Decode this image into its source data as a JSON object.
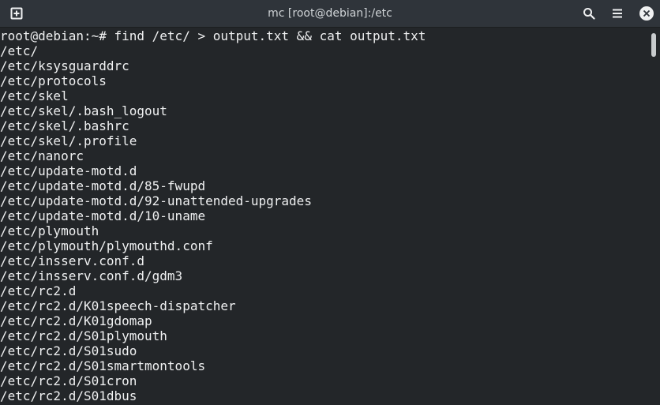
{
  "window": {
    "title": "mc [root@debian]:/etc"
  },
  "icons": {
    "new_tab": "new-tab-icon",
    "search": "search-icon",
    "menu": "hamburger-menu-icon",
    "close": "close-icon"
  },
  "terminal": {
    "lines": [
      "root@debian:~# find /etc/ > output.txt && cat output.txt",
      "/etc/",
      "/etc/ksysguarddrc",
      "/etc/protocols",
      "/etc/skel",
      "/etc/skel/.bash_logout",
      "/etc/skel/.bashrc",
      "/etc/skel/.profile",
      "/etc/nanorc",
      "/etc/update-motd.d",
      "/etc/update-motd.d/85-fwupd",
      "/etc/update-motd.d/92-unattended-upgrades",
      "/etc/update-motd.d/10-uname",
      "/etc/plymouth",
      "/etc/plymouth/plymouthd.conf",
      "/etc/insserv.conf.d",
      "/etc/insserv.conf.d/gdm3",
      "/etc/rc2.d",
      "/etc/rc2.d/K01speech-dispatcher",
      "/etc/rc2.d/K01gdomap",
      "/etc/rc2.d/S01plymouth",
      "/etc/rc2.d/S01sudo",
      "/etc/rc2.d/S01smartmontools",
      "/etc/rc2.d/S01cron",
      "/etc/rc2.d/S01dbus"
    ]
  },
  "colors": {
    "titlebar_bg": "#2f343a",
    "terminal_bg": "#232629",
    "text": "#eff0f1"
  }
}
